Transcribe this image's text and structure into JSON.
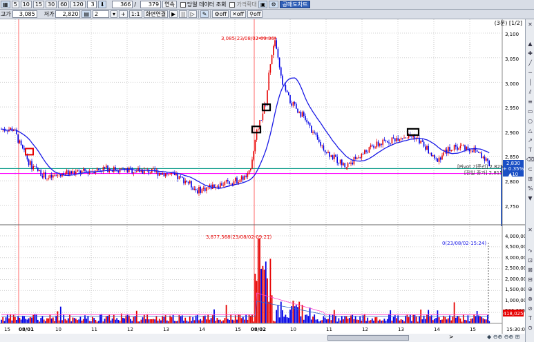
{
  "toolbar1": {
    "periods": [
      "5",
      "10",
      "15",
      "30",
      "60",
      "120"
    ],
    "interval_value": "3",
    "count_value": "366",
    "slash": "/",
    "total_value": "379",
    "continuous_label": "연속",
    "today_data_label": "당일 데이터 조회",
    "price_expand_label": "가격확대",
    "short_chart_label": "공매도차트"
  },
  "toolbar2": {
    "high_label": "고가",
    "high_value": "3,085",
    "low_label": "저가",
    "low_value": "2,820",
    "split_value": "2",
    "plus_label": "+",
    "one_to_one_label": "1:1",
    "screen_link_label": "화면연결",
    "play_controls": [
      "▶",
      "||",
      "▷"
    ],
    "off_buttons": [
      "off",
      "off",
      "off"
    ]
  },
  "chart_header": {
    "period_indicator": "(3분) [1/2]"
  },
  "price_panel": {
    "y_ticks": [
      "3,100",
      "3,050",
      "3,000",
      "2,950",
      "2,900",
      "2,850",
      "2,800",
      "2,750"
    ],
    "max_annotation": "3,085(23/08/02-09:36)",
    "pivot_label": "[Pivot 기준선] 2,825",
    "prev_close_label": "[전일 종가] 2,815",
    "current_price_box": "2,830",
    "change_pct": "+ 0.35%",
    "change_value": "▲10",
    "colors": {
      "pivot_line": "#139e8e",
      "prev_close_line": "#ff00ff",
      "ma_line": "#1a1ae6",
      "up": "#e60000",
      "down": "#0000e6"
    }
  },
  "volume_panel": {
    "y_ticks": [
      "4,000,000",
      "3,500,000",
      "3,000,000",
      "2,500,000",
      "2,000,000",
      "1,500,000",
      "1,000,000",
      "500,000"
    ],
    "max_annotation": "3,877,568(23/08/02-09:27)",
    "min_annotation": "0(23/08/02-15:24)",
    "current_volume": "418,025"
  },
  "x_axis": {
    "labels": [
      "15",
      "08/01",
      "10",
      "11",
      "12",
      "13",
      "14",
      "15",
      "08/02",
      "10",
      "11",
      "12",
      "13",
      "14",
      "15"
    ],
    "right_time": "15:30:00"
  },
  "chart_data": {
    "type": "candlestick",
    "y_range": [
      2740,
      3110
    ],
    "max_price": 3085,
    "min_price": 2820,
    "pivot": 2825,
    "prev_close": 2815,
    "last_price": 2830,
    "volume_max": 3877568
  }
}
